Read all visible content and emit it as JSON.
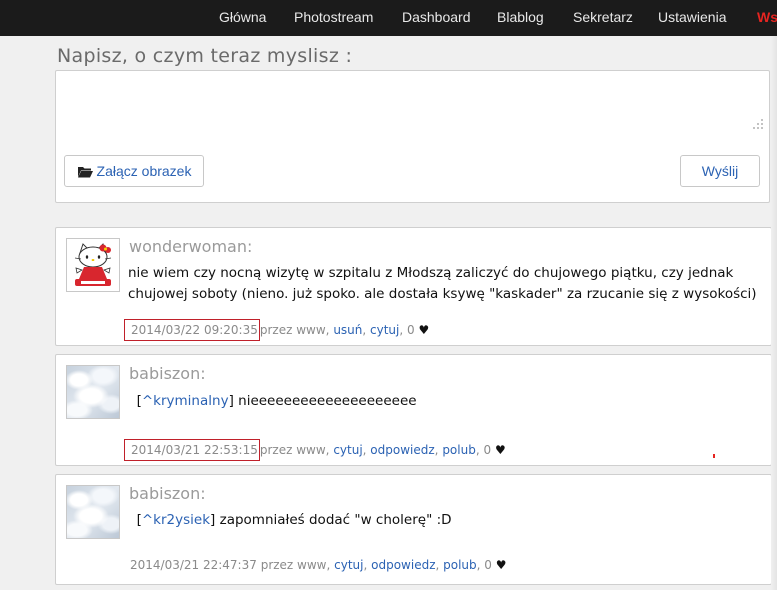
{
  "nav": {
    "items": [
      "Główna",
      "Photostream",
      "Dashboard",
      "Blablog",
      "Sekretarz",
      "Ustawienia",
      "Wsp"
    ]
  },
  "compose": {
    "title": "Napisz, o czym teraz myslisz :",
    "placeholder": "",
    "attach_label": "Załącz obrazek",
    "send_label": "Wyślij"
  },
  "posts": [
    {
      "username": "wonderwoman:",
      "avatar": "hello-kitty-avatar",
      "text": "  nie wiem czy nocną wizytę w szpitalu z Młodszą zaliczyć do chujowego piątku, czy jednak chujowej soboty (nieno. już spoko. ale dostała ksywę \"kaskader\" za rzucanie się z wysokości)",
      "timestamp": "2014/03/22 09:20:35",
      "via": "przez www",
      "actions": [
        "usuń",
        "cytuj"
      ],
      "likes": "0"
    },
    {
      "username": "babiszon:",
      "avatar": "clouds-avatar",
      "tag": "^kryminalny",
      "text": " nieeeeeeeeeeeeeeeeeeee",
      "timestamp": "2014/03/21 22:53:15",
      "via": "przez www",
      "actions": [
        "cytuj",
        "odpowiedz",
        "polub"
      ],
      "likes": "0"
    },
    {
      "username": "babiszon:",
      "avatar": "clouds-avatar",
      "tag": "^kr2ysiek",
      "text": " zapomniałeś dodać \"w cholerę\" :D",
      "timestamp": "2014/03/21 22:47:37",
      "via": "przez www",
      "actions": [
        "cytuj",
        "odpowiedz",
        "polub"
      ],
      "likes": "0"
    }
  ],
  "colors": {
    "nav_bg": "#1b1b1b",
    "accent_red": "#e52420",
    "link": "#2b62b3",
    "highlight_box": "#c0202a"
  }
}
